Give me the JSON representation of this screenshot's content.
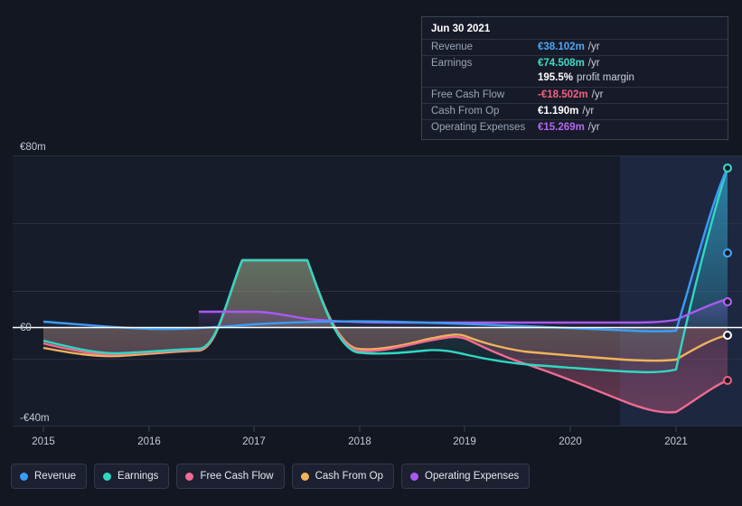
{
  "tooltip": {
    "title": "Jun 30 2021",
    "rows": [
      {
        "label": "Revenue",
        "value": "€38.102m",
        "unit": "/yr",
        "color": "#4da6f7"
      },
      {
        "label": "Earnings",
        "value": "€74.508m",
        "unit": "/yr",
        "color": "#3ddcc6",
        "sub_value": "195.5%",
        "sub_note": "profit margin"
      },
      {
        "label": "Free Cash Flow",
        "value": "-€18.502m",
        "unit": "/yr",
        "color": "#f1607e"
      },
      {
        "label": "Cash From Op",
        "value": "€1.190m",
        "unit": "/yr",
        "color": "#ffffff"
      },
      {
        "label": "Operating Expenses",
        "value": "€15.269m",
        "unit": "/yr",
        "color": "#b566f0"
      }
    ]
  },
  "legend": {
    "items": [
      {
        "label": "Revenue",
        "color": "#3b9cf5"
      },
      {
        "label": "Earnings",
        "color": "#2ed9c3"
      },
      {
        "label": "Free Cash Flow",
        "color": "#f06b92"
      },
      {
        "label": "Cash From Op",
        "color": "#efb35a"
      },
      {
        "label": "Operating Expenses",
        "color": "#a95af0"
      }
    ]
  },
  "axis": {
    "y_top_label": "€80m",
    "y_zero_label": "€0",
    "y_bottom_label": "-€40m",
    "x_labels": [
      "2015",
      "2016",
      "2017",
      "2018",
      "2019",
      "2020",
      "2021"
    ]
  },
  "chart_data": {
    "type": "area",
    "title": "",
    "xlabel": "",
    "ylabel": "€m per year",
    "ylim": [
      -40,
      80
    ],
    "xlim": [
      "2014-09",
      "2021-09"
    ],
    "grid": true,
    "legend_position": "bottom",
    "x": [
      "2015.0",
      "2015.25",
      "2015.5",
      "2015.75",
      "2016.0",
      "2016.25",
      "2016.5",
      "2016.75",
      "2017.0",
      "2017.25",
      "2017.5",
      "2017.75",
      "2018.0",
      "2018.25",
      "2018.5",
      "2018.75",
      "2019.0",
      "2019.25",
      "2019.5",
      "2019.75",
      "2020.0",
      "2020.25",
      "2020.5",
      "2020.75",
      "2021.0",
      "2021.25",
      "2021.5"
    ],
    "series": [
      {
        "name": "Revenue",
        "color": "#3b9cf5",
        "values": [
          1.5,
          1.0,
          0.5,
          0.0,
          -0.5,
          -0.5,
          0.0,
          0.5,
          1.0,
          1.2,
          1.3,
          1.4,
          1.5,
          1.6,
          1.6,
          1.5,
          1.2,
          0.8,
          0.5,
          0.2,
          -0.2,
          -0.5,
          -0.8,
          -1.0,
          -1.0,
          12.0,
          38.1
        ]
      },
      {
        "name": "Earnings",
        "color": "#2ed9c3",
        "values": [
          -4.0,
          -5.0,
          -6.0,
          -6.5,
          -6.5,
          -6.0,
          -6.0,
          -5.5,
          30.0,
          33.0,
          33.0,
          33.0,
          -7.5,
          -8.0,
          -8.5,
          -8.0,
          -6.0,
          -6.5,
          -7.5,
          -8.0,
          -8.5,
          -9.0,
          -9.5,
          -10.0,
          -9.0,
          25.0,
          74.5
        ]
      },
      {
        "name": "Free Cash Flow",
        "color": "#f06b92",
        "values": [
          -5.0,
          -6.0,
          -7.0,
          -7.5,
          -7.0,
          -6.5,
          -6.5,
          -6.0,
          30.0,
          33.0,
          33.0,
          33.0,
          -7.0,
          -7.5,
          -8.0,
          -7.5,
          -5.5,
          -5.0,
          -7.0,
          -9.0,
          -12.0,
          -15.0,
          -18.0,
          -21.0,
          -23.0,
          -20.0,
          -18.5
        ]
      },
      {
        "name": "Cash From Op",
        "color": "#efb35a",
        "values": [
          -4.5,
          -5.5,
          -6.5,
          -7.0,
          -6.5,
          -6.0,
          -6.0,
          -5.5,
          30.5,
          33.5,
          33.5,
          33.5,
          -6.5,
          -7.0,
          -7.5,
          -7.0,
          -5.0,
          -4.5,
          -6.0,
          -7.0,
          -7.5,
          -8.0,
          -8.5,
          -9.0,
          -9.5,
          -3.0,
          1.2
        ]
      },
      {
        "name": "Operating Expenses",
        "color": "#a95af0",
        "values": [
          null,
          null,
          null,
          null,
          null,
          null,
          3.0,
          3.0,
          3.0,
          2.8,
          2.5,
          2.2,
          2.0,
          2.0,
          2.0,
          2.0,
          2.0,
          2.0,
          2.0,
          2.0,
          2.0,
          2.0,
          2.0,
          2.0,
          2.5,
          8.0,
          15.3
        ]
      }
    ],
    "forecast_region": {
      "from": "2021.0",
      "to": "2021.6",
      "shaded": true
    }
  }
}
